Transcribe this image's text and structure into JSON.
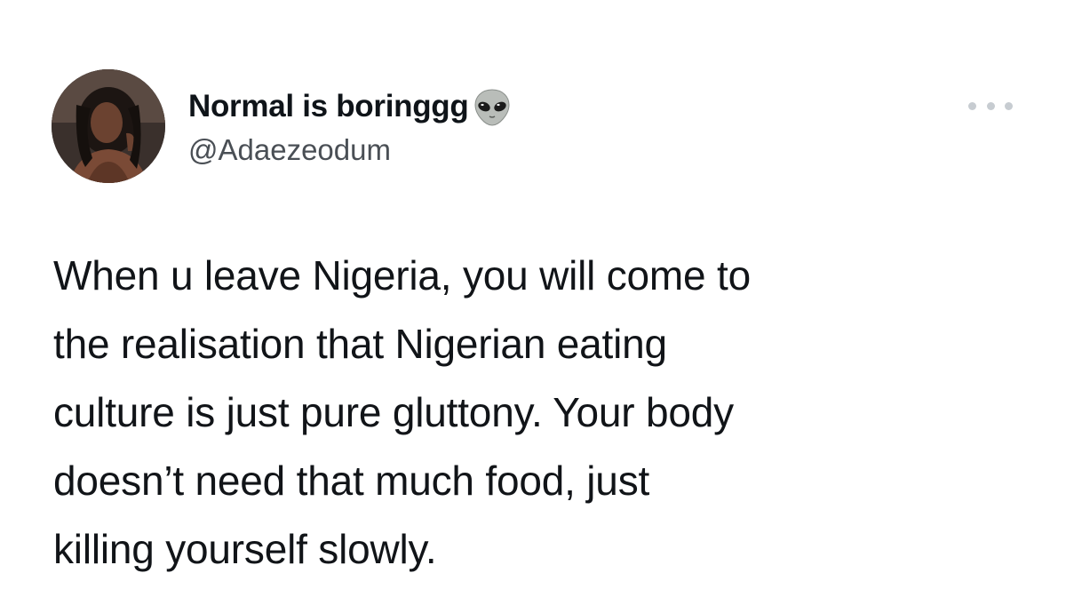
{
  "user": {
    "display_name": "Normal is boringgg",
    "name_emoji": "alien-icon",
    "handle": "@Adaezeodum",
    "avatar": "avatar-photo"
  },
  "menu": {
    "icon": "more-options-icon"
  },
  "tweet": {
    "lines": [
      "When u leave Nigeria, you will come to",
      "the realisation that Nigerian eating",
      "culture is just pure gluttony. Your body",
      "doesn’t need that much food, just",
      "killing yourself slowly."
    ]
  }
}
